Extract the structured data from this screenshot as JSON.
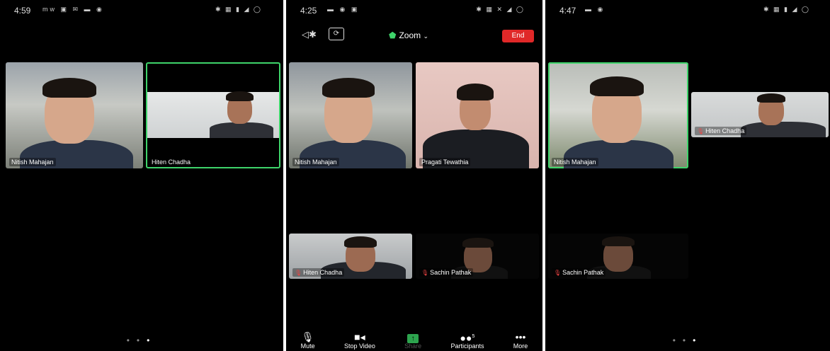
{
  "screens": [
    {
      "status": {
        "time": "4:59",
        "left_icons": "mw ▣ ✉ ▬ ◉",
        "right_icons": "✱ ▦ ▮ ◢ ◯"
      },
      "tiles": [
        {
          "name": "Nitish Mahajan"
        },
        {
          "name": "Hiten Chadha"
        }
      ],
      "page_dots": "• • •"
    },
    {
      "status": {
        "time": "4:25",
        "left_icons": "▬ ◉ ▣",
        "right_icons": "✱ ▦ ✕ ◢ ◯"
      },
      "topbar": {
        "title": "Zoom",
        "end_label": "End"
      },
      "tiles": [
        {
          "name": "Nitish Mahajan"
        },
        {
          "name": "Pragati Tewathia"
        },
        {
          "name": "Hiten Chadha"
        },
        {
          "name": "Sachin Pathak"
        }
      ],
      "toolbar": [
        {
          "label": "Mute",
          "icon": "microphone-icon"
        },
        {
          "label": "Stop Video",
          "icon": "video-camera-icon"
        },
        {
          "label": "Share",
          "icon": "share-icon"
        },
        {
          "label": "Participants",
          "icon": "participants-icon",
          "count": "5"
        },
        {
          "label": "More",
          "icon": "more-icon"
        }
      ]
    },
    {
      "status": {
        "time": "4:47",
        "left_icons": "▬ ◉",
        "right_icons": "✱ ▦ ▮ ◢ ◯"
      },
      "tiles": [
        {
          "name": "Nitish Mahajan"
        },
        {
          "name": "Hiten Chadha"
        },
        {
          "name": "Sachin Pathak"
        }
      ],
      "page_dots": "• • •"
    }
  ],
  "colors": {
    "active_speaker": "#3ed36a",
    "end_button": "#e02828",
    "share_button": "#2da44e",
    "background": "#000000"
  }
}
